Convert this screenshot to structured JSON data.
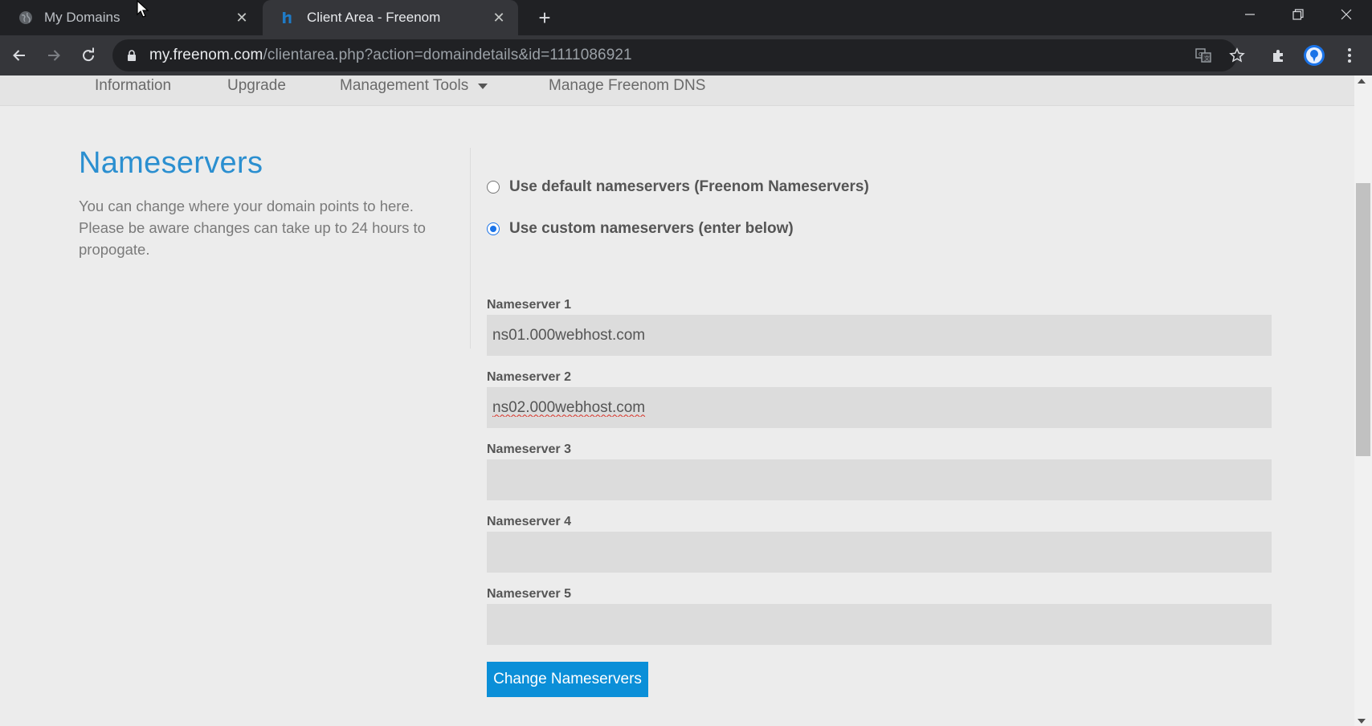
{
  "browser": {
    "tabs": [
      {
        "title": "My Domains",
        "favicon": "globe-icon",
        "active": false
      },
      {
        "title": "Client Area - Freenom",
        "favicon": "freenom-icon",
        "active": true
      }
    ],
    "url_host": "my.freenom.com",
    "url_path": "/clientarea.php?action=domaindetails&id=1111086921"
  },
  "subnav": {
    "information": "Information",
    "upgrade": "Upgrade",
    "management_tools": "Management Tools",
    "manage_dns": "Manage Freenom DNS"
  },
  "section": {
    "title": "Nameservers",
    "description": "You can change where your domain points to here. Please be aware changes can take up to 24 hours to propogate."
  },
  "options": {
    "default_label": "Use default nameservers (Freenom Nameservers)",
    "custom_label": "Use custom nameservers (enter below)",
    "selected": "custom"
  },
  "nameservers": [
    {
      "label": "Nameserver 1",
      "value": "ns01.000webhost.com"
    },
    {
      "label": "Nameserver 2",
      "value": "ns02.000webhost.com"
    },
    {
      "label": "Nameserver 3",
      "value": ""
    },
    {
      "label": "Nameserver 4",
      "value": ""
    },
    {
      "label": "Nameserver 5",
      "value": ""
    }
  ],
  "submit_label": "Change Nameservers",
  "colors": {
    "accent": "#2b8fd0",
    "button": "#0b8fd8",
    "chrome_dark": "#202124"
  }
}
